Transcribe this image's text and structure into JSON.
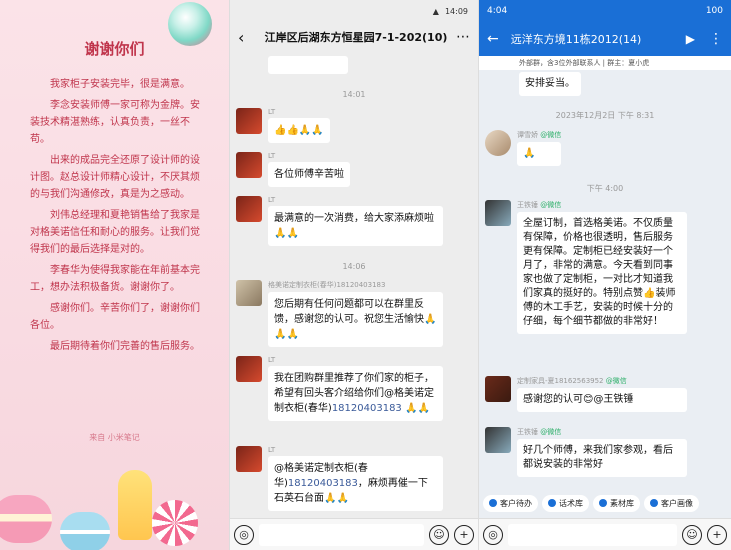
{
  "note": {
    "title": "谢谢你们",
    "paragraphs": [
      "我家柜子安装完毕，很是满意。",
      "李念安装师傅一家可称为金牌。安装技术精湛熟练，认真负责，一丝不苟。",
      "出来的成品完全还原了设计师的设计图。赵总设计师精心设计，不厌其烦的与我们沟通修改，真是为之感动。",
      "刘伟总经理和夏艳销售给了我家是对格美诺信任和耐心的服务。让我们觉得我们的最后选择是对的。",
      "李春华为使得我家能在年前基本完工，想办法积极备货。谢谢你了。",
      "感谢你们。辛苦你们了，谢谢你们各位。",
      "最后期待着你们完善的售后服务。"
    ],
    "source": "来自 小米笔记"
  },
  "chat1": {
    "status_time": "14:09",
    "title": "江岸区后湖东方恒星园7-1-202(10)",
    "times": [
      "14:01",
      "14:06"
    ],
    "messages": [
      {
        "name": "LT",
        "text": "👍👍🙏🙏"
      },
      {
        "name": "LT",
        "text": "各位师傅辛苦啦"
      },
      {
        "name": "LT",
        "text": "最满意的一次消费，给大家添麻烦啦🙏🙏"
      },
      {
        "name": "格美诺定制衣柜(春华)18120403183",
        "text": "您后期有任何问题都可以在群里反馈，感谢您的认可。祝您生活愉快🙏🙏🙏"
      },
      {
        "name": "LT",
        "text_pre": "我在团购群里推荐了你们家的柜子，希望有回头客介绍给你们@格美诺定制衣柜(春华)",
        "phone": "18120403183",
        "text_post": " 🙏🙏"
      },
      {
        "name": "LT",
        "text_pre": "@格美诺定制衣柜(春华)",
        "phone": "18120403183",
        "text_post": "，麻烦再催一下石英石台面🙏🙏"
      }
    ]
  },
  "chat2": {
    "status_time": "4:04",
    "battery": "100",
    "title": "远洋东方境11栋2012(14)",
    "subtitle": "外部群，含3位外部联系人 | 群主：夏小虎",
    "top_bubble": "安排妥当。",
    "date_time": "2023年12月2日 下午 8:31",
    "time2": "下午 4:00",
    "messages": [
      {
        "name": "谭雪娇",
        "wx": "@微信",
        "text": "🙏"
      },
      {
        "name": "王铁锤",
        "wx": "@微信",
        "text": "全屋订制，首选格美诺。不仅质量有保障，价格也很透明，售后服务更有保障。定制柜已经安装好一个月了，非常的满意。今天看到同事家也做了定制柜，一对比才知道我们家真的挺好的。特别点赞👍装师傅的木工手艺，安装的时候十分的仔细，每个细节都做的非常好！"
      },
      {
        "name": "定制家具-夏18162563952",
        "wx": "@微信",
        "text": "感谢您的认可😊@王铁锤"
      },
      {
        "name": "王铁锤",
        "wx": "@微信",
        "text": "好几个师傅，来我们家参观，看后都说安装的非常好"
      }
    ],
    "quick": [
      "客户待办",
      "话术库",
      "素材库",
      "客户画像"
    ]
  }
}
